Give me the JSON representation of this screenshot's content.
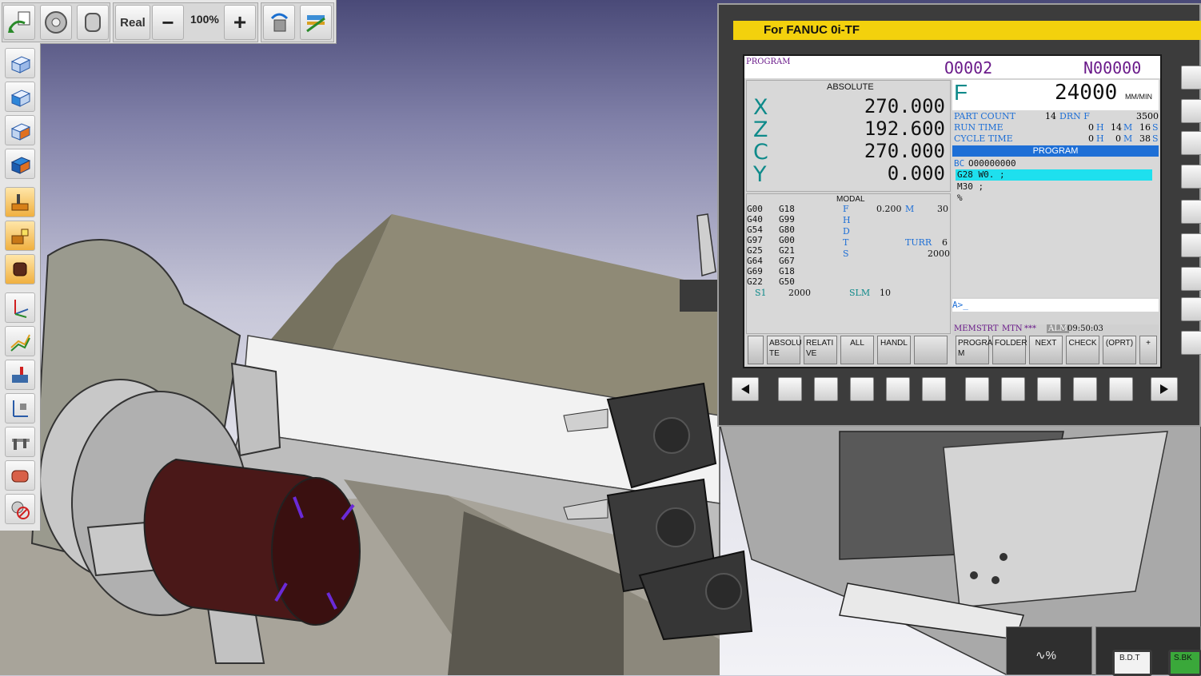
{
  "toolbar": {
    "view_mode": "Real",
    "zoom": "100%",
    "zoom_out": "−",
    "zoom_in": "+"
  },
  "left_toolbar": {
    "icons": [
      "view-iso-icon",
      "view-front-icon",
      "view-side-icon",
      "view-top-icon",
      "machine-setup-icon",
      "workpiece-icon",
      "stock-icon",
      "coordinate-system-icon",
      "toolpath-icon",
      "tool-table-icon",
      "measure-icon",
      "caliper-icon",
      "material-icon",
      "visibility-icon"
    ]
  },
  "cnc": {
    "brand": "For FANUC 0i-TF",
    "screen_title": "PROGRAM",
    "program_number": "O0002",
    "sequence_number": "N00000",
    "absolute_label": "ABSOLUTE",
    "axes": [
      {
        "letter": "X",
        "value": "270.000"
      },
      {
        "letter": "Z",
        "value": "192.600"
      },
      {
        "letter": "C",
        "value": "270.000"
      },
      {
        "letter": "Y",
        "value": "0.000"
      }
    ],
    "feed_letter": "F",
    "feed_value": "24000",
    "feed_unit": "MM/MIN",
    "part_count_label": "PART COUNT",
    "part_count": "14",
    "drn_label": "DRN F",
    "drn_value": "3500",
    "run_time_label": "RUN TIME",
    "run_time": [
      "0",
      "H",
      "14",
      "M",
      "16",
      "S"
    ],
    "cycle_time_label": "CYCLE TIME",
    "cycle_time": [
      "0",
      "H",
      "0",
      "M",
      "38",
      "S"
    ],
    "program_header": "PROGRAM",
    "program_lines": [
      {
        "prefix": "BC",
        "text": "O00000000"
      },
      {
        "prefix": "",
        "text": "G28 W0. ;"
      },
      {
        "prefix": "",
        "text": "M30 ;"
      },
      {
        "prefix": "",
        "text": "%"
      }
    ],
    "modal_label": "MODAL",
    "modal_codes": [
      [
        "G00",
        "G18"
      ],
      [
        "G40",
        "G99"
      ],
      [
        "G54",
        "G80"
      ],
      [
        "G97",
        "G00"
      ],
      [
        "G25",
        "G21"
      ],
      [
        "G64",
        "G67"
      ],
      [
        "G69",
        "G18"
      ],
      [
        "G22",
        "G50"
      ]
    ],
    "modal_letters": [
      "F",
      "H",
      "D",
      "T",
      "S"
    ],
    "modal_f_value": "0.200",
    "modal_m_label": "M",
    "modal_m_value": "30",
    "turr_label": "TURR",
    "turr_value": "6",
    "modal_s_value": "2000",
    "s1_label": "S1",
    "s1_value": "2000",
    "slm_label": "SLM",
    "slm_value": "10",
    "input_prompt": "A>_",
    "status": [
      "MEM",
      "STRT",
      "MTN",
      "***",
      "ALM",
      "09:50:03"
    ],
    "softkeys": [
      "",
      "ABSOLU TE",
      "RELATI VE",
      "ALL",
      "HANDL",
      "",
      "PROGRA M",
      "FOLDER",
      "NEXT",
      "CHECK",
      "(OPRT)",
      "+"
    ]
  },
  "bottom_controls": {
    "feed_override": "∿%",
    "bdt": "B.D.T",
    "sbk": "S.BK"
  },
  "colors": {
    "brand_yellow": "#f3d10d",
    "axis_teal": "#0e8a8a",
    "label_blue": "#1e6fd6",
    "highlight_cyan": "#1ee0ee",
    "program_purple": "#6a1a8a",
    "workpiece": "#4a1818"
  }
}
